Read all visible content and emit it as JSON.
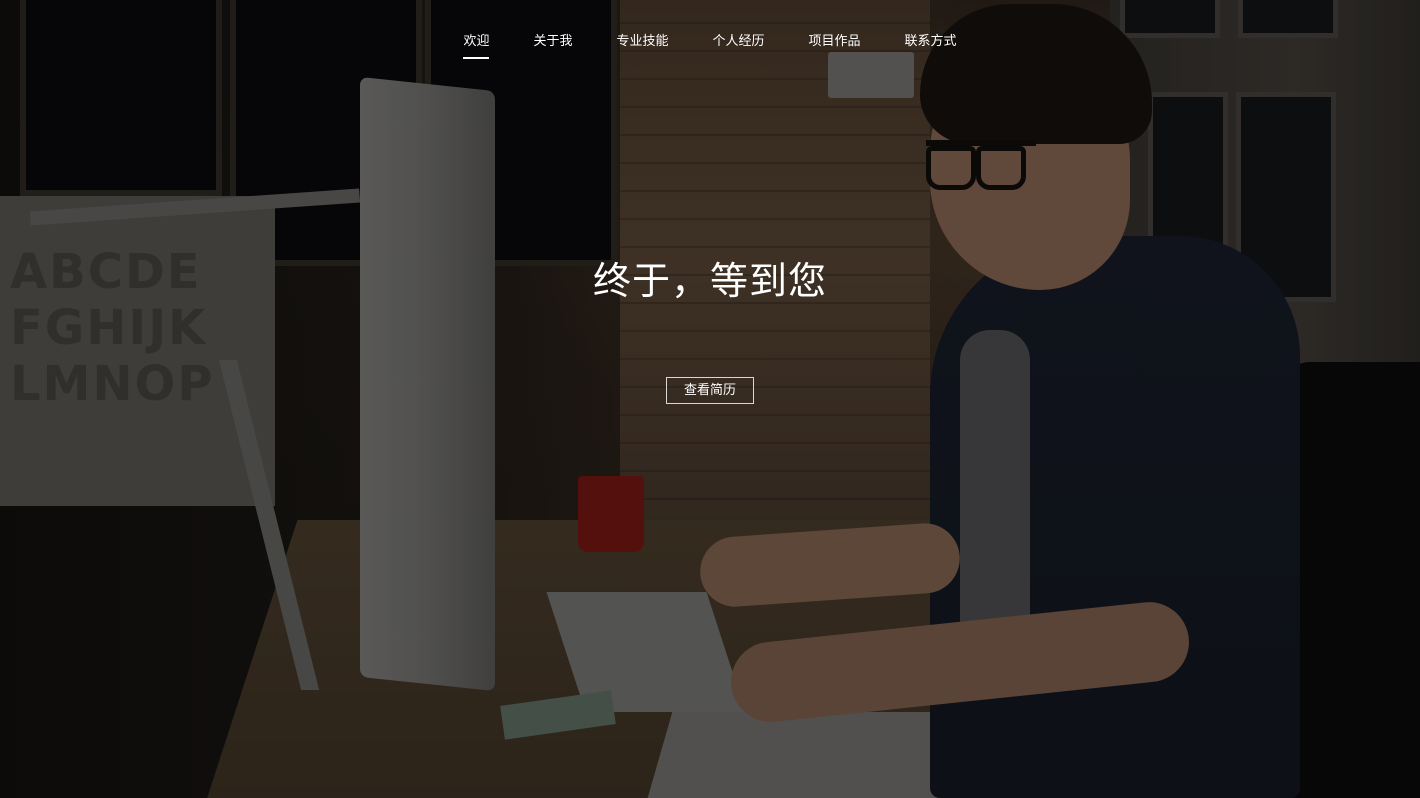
{
  "nav": {
    "items": [
      {
        "label": "欢迎",
        "active": true
      },
      {
        "label": "关于我",
        "active": false
      },
      {
        "label": "专业技能",
        "active": false
      },
      {
        "label": "个人经历",
        "active": false
      },
      {
        "label": "项目作品",
        "active": false
      },
      {
        "label": "联系方式",
        "active": false
      }
    ]
  },
  "hero": {
    "headline": "终于，等到您",
    "cta_label": "查看简历",
    "poster_text": "ABCDE FGHIJK LMNOP"
  },
  "colors": {
    "text": "#ffffff",
    "cta_border": "#d8d8d8",
    "overlay": "rgba(0,0,0,0.42)"
  }
}
